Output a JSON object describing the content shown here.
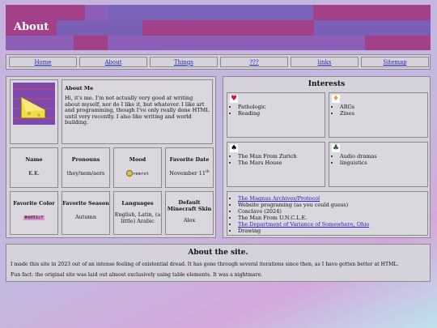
{
  "header": {
    "title": "About",
    "accent": "#a3408a",
    "base": "#8d5fb8"
  },
  "nav": [
    "Home",
    "About",
    "Things",
    "???",
    "links",
    "Sitemap"
  ],
  "about_me": {
    "title": "About Me",
    "text": "Hi, it's me. I'm not actually very good at writing about myself, nor do I like it, but whatever. I like art and programming, though I've only really done HTML until very recently. I also like writing and world building."
  },
  "info": [
    {
      "label": "Name",
      "value": "K.K."
    },
    {
      "label": "Pronouns",
      "value": "they/xem/aers"
    },
    {
      "label": "Mood",
      "value": "remrot"
    },
    {
      "label": "Favorite Date",
      "value": "November 11",
      "sup": "th"
    },
    {
      "label": "Favorite Color",
      "value": "#dd91cf"
    },
    {
      "label": "Favorite Season",
      "value": "Autumn"
    },
    {
      "label": "Languages",
      "value": "English, Latin, (a little) Arabic"
    },
    {
      "label": "Default Minecraft Skin",
      "value": "Alex"
    }
  ],
  "interests": {
    "title": "Interests",
    "hearts": [
      "Pathologic",
      "Reading"
    ],
    "diamonds": [
      "ARGs",
      "Zines"
    ],
    "spades": [
      "The Man From Zurich",
      "The Mars House"
    ],
    "clubs": [
      "Audio dramas",
      "linguistics"
    ],
    "list": [
      {
        "text": "The Magnus Archives/Protocol",
        "link": true
      },
      {
        "text": "Website programing (as you could guess)",
        "link": false
      },
      {
        "text": "Conclave (2024)",
        "link": false
      },
      {
        "text": "The Man From U.N.C.L.E.",
        "link": false
      },
      {
        "text": "The Department of Variance of Somewhere, Ohio",
        "link": true
      },
      {
        "text": "Drawing",
        "link": false
      }
    ]
  },
  "site": {
    "title": "About the site.",
    "p1": "I made this site in 2023 out of an intense feeling of existential dread. It has gone through several iterations since then, as I have gotten better at HTML.",
    "p2": "Fun fact: the original site was laid out almost exclusively using table elements. It was a nightmare."
  }
}
